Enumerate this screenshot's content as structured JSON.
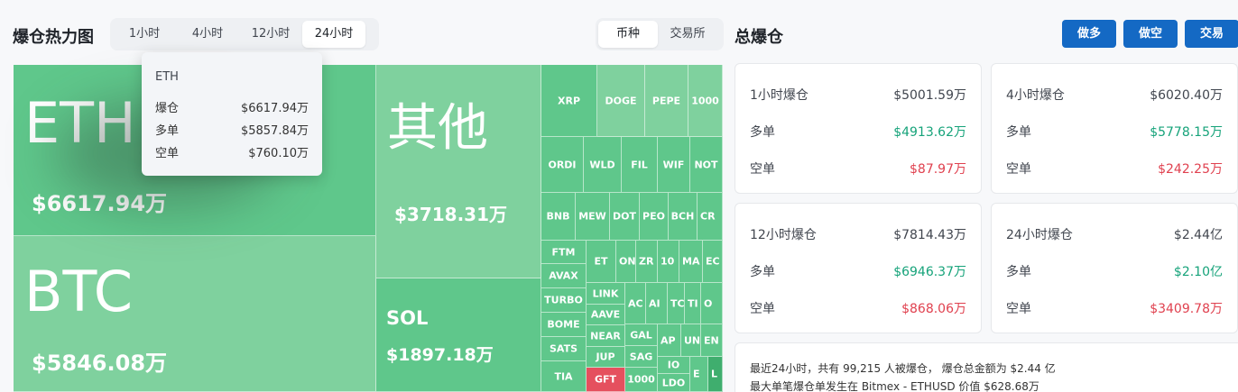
{
  "heatmap": {
    "title": "爆仓热力图",
    "time_tabs": [
      "1小时",
      "4小时",
      "12小时",
      "24小时"
    ],
    "active_time_tab": "24小时",
    "type_tabs": [
      "币种",
      "交易所"
    ],
    "active_type_tab": "币种",
    "cells": [
      {
        "id": "eth",
        "symbol": "ETH",
        "amount": "$6617.94万",
        "shade": "mid"
      },
      {
        "id": "btc",
        "symbol": "BTC",
        "amount": "$5846.08万",
        "shade": "light"
      },
      {
        "id": "other",
        "symbol": "其他",
        "amount": "$3718.31万",
        "shade": "light"
      },
      {
        "id": "sol",
        "symbol": "SOL",
        "amount": "$1897.18万",
        "shade": "mid"
      },
      {
        "id": "xrp",
        "symbol": "XRP",
        "shade": "mid"
      },
      {
        "id": "doge",
        "symbol": "DOGE",
        "shade": "light"
      },
      {
        "id": "pepe",
        "symbol": "PEPE",
        "shade": "light"
      },
      {
        "id": "1000",
        "symbol": "1000",
        "shade": "light"
      },
      {
        "id": "ordi",
        "symbol": "ORDI",
        "shade": "mid"
      },
      {
        "id": "wld",
        "symbol": "WLD",
        "shade": "mid"
      },
      {
        "id": "fil",
        "symbol": "FIL",
        "shade": "mid"
      },
      {
        "id": "wif",
        "symbol": "WIF",
        "shade": "mid"
      },
      {
        "id": "not",
        "symbol": "NOT",
        "shade": "mid"
      },
      {
        "id": "bnb",
        "symbol": "BNB",
        "shade": "mid"
      },
      {
        "id": "mew",
        "symbol": "MEW",
        "shade": "mid"
      },
      {
        "id": "dot",
        "symbol": "DOT",
        "shade": "mid"
      },
      {
        "id": "peo",
        "symbol": "PEO",
        "shade": "mid"
      },
      {
        "id": "bch",
        "symbol": "BCH",
        "shade": "mid"
      },
      {
        "id": "cr",
        "symbol": "CR",
        "shade": "mid"
      },
      {
        "id": "ftm",
        "symbol": "FTM",
        "shade": "mid"
      },
      {
        "id": "avax",
        "symbol": "AVAX",
        "shade": "mid"
      },
      {
        "id": "turbo",
        "symbol": "TURBO",
        "shade": "mid"
      },
      {
        "id": "bome",
        "symbol": "BOME",
        "shade": "mid"
      },
      {
        "id": "sats",
        "symbol": "SATS",
        "shade": "mid"
      },
      {
        "id": "tia",
        "symbol": "TIA",
        "shade": "mid"
      },
      {
        "id": "et",
        "symbol": "ET",
        "shade": "mid"
      },
      {
        "id": "on",
        "symbol": "ON",
        "shade": "mid"
      },
      {
        "id": "zr",
        "symbol": "ZR",
        "shade": "mid"
      },
      {
        "id": "10",
        "symbol": "10",
        "shade": "mid"
      },
      {
        "id": "ma",
        "symbol": "MA",
        "shade": "mid"
      },
      {
        "id": "ec",
        "symbol": "EC",
        "shade": "mid"
      },
      {
        "id": "link",
        "symbol": "LINK",
        "shade": "mid"
      },
      {
        "id": "aave",
        "symbol": "AAVE",
        "shade": "mid"
      },
      {
        "id": "near",
        "symbol": "NEAR",
        "shade": "mid"
      },
      {
        "id": "jup",
        "symbol": "JUP",
        "shade": "mid"
      },
      {
        "id": "gft",
        "symbol": "GFT",
        "shade": "red"
      },
      {
        "id": "ac",
        "symbol": "AC",
        "shade": "mid"
      },
      {
        "id": "ai",
        "symbol": "AI",
        "shade": "mid"
      },
      {
        "id": "tc",
        "symbol": "TC",
        "shade": "mid"
      },
      {
        "id": "ti",
        "symbol": "TI",
        "shade": "mid"
      },
      {
        "id": "o",
        "symbol": "O",
        "shade": "mid"
      },
      {
        "id": "gal",
        "symbol": "GAL",
        "shade": "mid"
      },
      {
        "id": "ap",
        "symbol": "AP",
        "shade": "mid"
      },
      {
        "id": "un",
        "symbol": "UN",
        "shade": "mid"
      },
      {
        "id": "en",
        "symbol": "EN",
        "shade": "mid"
      },
      {
        "id": "sag",
        "symbol": "SAG",
        "shade": "mid"
      },
      {
        "id": "io",
        "symbol": "IO",
        "shade": "mid"
      },
      {
        "id": "1000b",
        "symbol": "1000",
        "shade": "mid"
      },
      {
        "id": "ldo",
        "symbol": "LDO",
        "shade": "mid"
      },
      {
        "id": "e",
        "symbol": "E",
        "shade": "mid"
      },
      {
        "id": "l",
        "symbol": "L",
        "shade": "dark"
      }
    ],
    "tooltip": {
      "title": "ETH",
      "rows": [
        {
          "label": "爆仓",
          "value": "$6617.94万"
        },
        {
          "label": "多单",
          "value": "$5857.84万"
        },
        {
          "label": "空单",
          "value": "$760.10万"
        }
      ]
    }
  },
  "liquidation": {
    "title": "总爆仓",
    "buttons": [
      "做多",
      "做空",
      "交易"
    ],
    "cards": [
      {
        "label": "1小时爆仓",
        "total": "$5001.59万",
        "long_label": "多单",
        "long": "$4913.62万",
        "short_label": "空单",
        "short": "$87.97万"
      },
      {
        "label": "4小时爆仓",
        "total": "$6020.40万",
        "long_label": "多单",
        "long": "$5778.15万",
        "short_label": "空单",
        "short": "$242.25万"
      },
      {
        "label": "12小时爆仓",
        "total": "$7814.43万",
        "long_label": "多单",
        "long": "$6946.37万",
        "short_label": "空单",
        "short": "$868.06万"
      },
      {
        "label": "24小时爆仓",
        "total": "$2.44亿",
        "long_label": "多单",
        "long": "$2.10亿",
        "short_label": "空单",
        "short": "$3409.78万"
      }
    ],
    "summary_line1": "最近24小时，共有 99,215 人被爆仓， 爆仓总金额为 $2.44 亿",
    "summary_line2": "最大单笔爆仓单发生在 Bitmex - ETHUSD 价值 $628.68万"
  },
  "colors": {
    "accent": "#1469c4",
    "cell_light": "#7fd19e",
    "cell_mid": "#5fc78b",
    "cell_dark": "#3fae6e",
    "cell_red": "#e5505e",
    "long_green": "#16a37a",
    "short_red": "#e0414f"
  }
}
